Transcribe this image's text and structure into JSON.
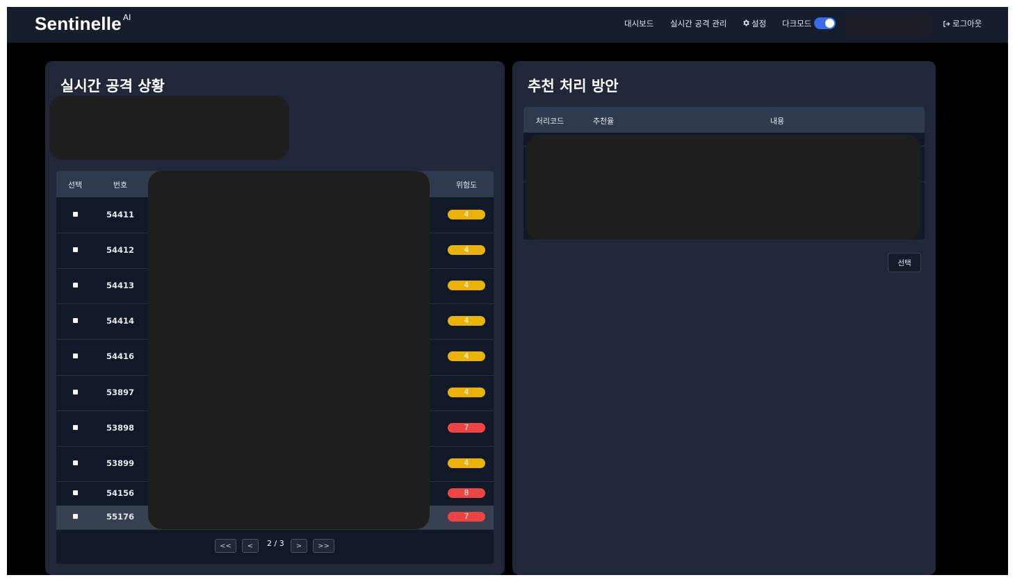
{
  "app": {
    "logo_text": "Sentinelle",
    "logo_superscript": "AI"
  },
  "nav": {
    "dashboard": "대시보드",
    "attack_management": "실시간 공격 관리",
    "settings": "설정",
    "dark_mode": "다크모드",
    "dark_mode_on": true,
    "logout": "로그아웃"
  },
  "left_panel": {
    "title": "실시간 공격 상황",
    "table": {
      "headers": {
        "select": "선택",
        "number": "번호",
        "risk": "위험도"
      },
      "rows": [
        {
          "number": "54411",
          "risk": "4",
          "level": "medium",
          "selected": false
        },
        {
          "number": "54412",
          "risk": "4",
          "level": "medium",
          "selected": false
        },
        {
          "number": "54413",
          "risk": "4",
          "level": "medium",
          "selected": false
        },
        {
          "number": "54414",
          "risk": "4",
          "level": "medium",
          "selected": false
        },
        {
          "number": "54416",
          "risk": "4",
          "level": "medium",
          "selected": false
        },
        {
          "number": "53897",
          "risk": "4",
          "level": "medium",
          "selected": false
        },
        {
          "number": "53898",
          "risk": "7",
          "level": "high",
          "selected": false
        },
        {
          "number": "53899",
          "risk": "4",
          "level": "medium",
          "selected": false
        },
        {
          "number": "54156",
          "risk": "8",
          "level": "high",
          "selected": false
        },
        {
          "number": "55176",
          "risk": "7",
          "level": "high",
          "selected": true
        }
      ]
    },
    "pagination": {
      "first": "<<",
      "prev": "<",
      "page_text": "2 / 3",
      "next": ">",
      "last": ">>"
    }
  },
  "right_panel": {
    "title": "추천 처리 방안",
    "table": {
      "headers": {
        "code": "처리코드",
        "rate": "추천율",
        "content": "내용"
      }
    },
    "select_button": "선택"
  },
  "colors": {
    "navbar": "#161d2c",
    "panel": "#1f2738",
    "table_body": "#111827",
    "table_header": "#303a4e",
    "risk_medium": "#eab308",
    "risk_high": "#ef4444",
    "toggle_on": "#3b6be8"
  }
}
